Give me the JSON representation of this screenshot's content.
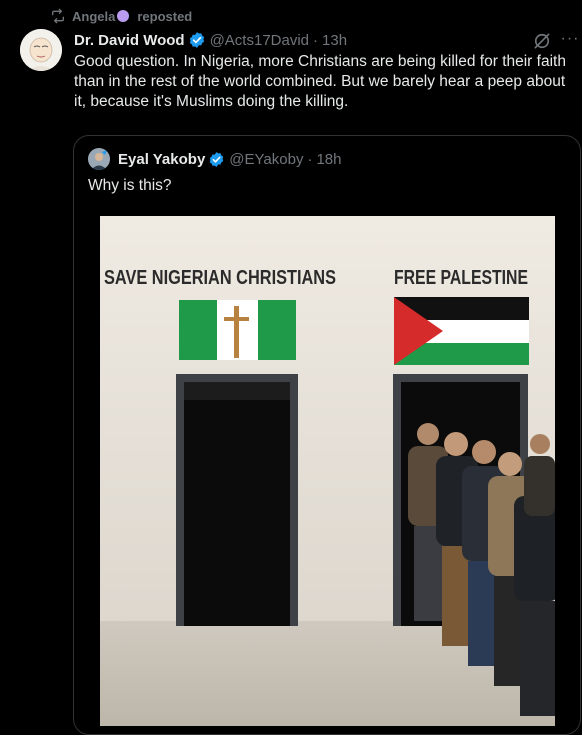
{
  "repost": {
    "user": "Angela",
    "label": "reposted"
  },
  "tweet": {
    "author_name": "Dr. David Wood",
    "handle": "@Acts17David",
    "separator": "·",
    "time": "13h",
    "text": "Good question. In Nigeria, more Christians are being killed for their faith than in the rest of the world combined. But we barely hear a peep about it, because it's Muslims doing the killing.",
    "more_glyph": "···"
  },
  "quoted": {
    "author_name": "Eyal Yakoby",
    "handle": "@EYakoby",
    "separator": "·",
    "time": "18h",
    "text": "Why is this?",
    "image": {
      "left_sign": "SAVE NIGERIAN CHRISTIANS",
      "right_sign": "FREE PALESTINE"
    }
  },
  "colors": {
    "accent": "#1d9bf0",
    "muted": "#71767b",
    "border": "#2f3336",
    "nigeria_green": "#1e9a49",
    "palestine_red": "#d52b2b"
  },
  "icons": {
    "repost": "repost-icon",
    "verified": "verified-badge-icon",
    "grok": "grok-icon",
    "more": "more-options-icon"
  }
}
